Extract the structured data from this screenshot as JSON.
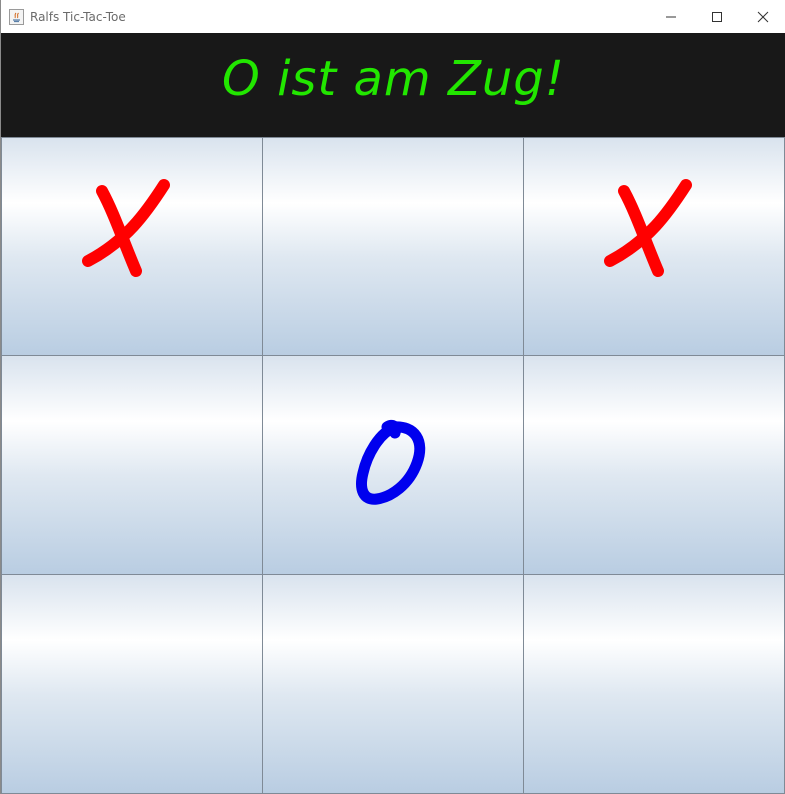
{
  "window": {
    "title": "Ralfs Tic-Tac-Toe",
    "icon": "java-app-icon"
  },
  "status": {
    "text": "O ist am Zug!",
    "color": "#22e600",
    "background": "#181818"
  },
  "board": {
    "cells": [
      [
        "X",
        "",
        "X"
      ],
      [
        "",
        "O",
        ""
      ],
      [
        "",
        "",
        ""
      ]
    ]
  },
  "colors": {
    "x": "#ff0000",
    "o": "#0000ee"
  }
}
